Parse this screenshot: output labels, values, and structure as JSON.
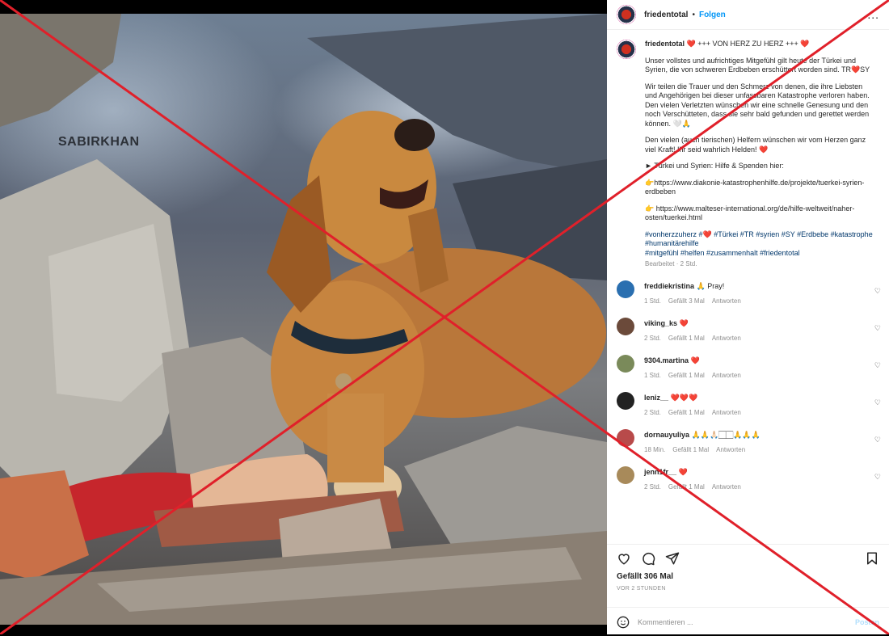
{
  "photo": {
    "watermark": "SABIRKHAN"
  },
  "header": {
    "username": "friedentotal",
    "separator": "•",
    "follow": "Folgen",
    "more": "..."
  },
  "caption": {
    "username": "friedentotal",
    "title": "❤️ +++ VON HERZ ZU HERZ +++ ❤️",
    "p1": "Unser vollstes und aufrichtiges Mitgefühl gilt heute der Türkei und Syrien, die von schweren Erdbeben erschüttert worden sind. TR❤️SY",
    "p2": "Wir teilen die Trauer und den Schmerz von denen, die ihre Liebsten und Angehörigen bei dieser unfassbaren Katastrophe verloren haben. Den vielen Verletzten wünschen wir eine schnelle Genesung und den noch Verschütteten, dass sie sehr bald gefunden und gerettet werden können. 🤍🙏",
    "p3": "Den vielen (auch tierischen) Helfern wünschen wir vom Herzen ganz viel Kraft! Ihr seid wahrlich Helden! ❤️",
    "p4": "► Türkei und Syrien: Hilfe & Spenden hier:",
    "p5": "👉https://www.diakonie-katastrophenhilfe.de/projekte/tuerkei-syrien-erdbeben",
    "p6": "👉 https://www.malteser-international.org/de/hilfe-weltweit/naher-osten/tuerkei.html",
    "tags": "#vonherzzuherz #❤️ #Türkei #TR #syrien #SY #Erdbebe #katastrophe #humanitärehilfe\n#mitgefühl #helfen #zusammenhalt #friedentotal",
    "edited": "Bearbeitet · 2 Std."
  },
  "comments": [
    {
      "user": "freddiekristina",
      "text": "🙏 Pray!",
      "time": "1 Std.",
      "likes": "Gefällt 3 Mal",
      "reply": "Antworten",
      "color": "#2a6fb0"
    },
    {
      "user": "viking_ks",
      "text": "❤️",
      "time": "2 Std.",
      "likes": "Gefällt 1 Mal",
      "reply": "Antworten",
      "color": "#6b4a3a"
    },
    {
      "user": "9304.martina",
      "text": "❤️",
      "time": "1 Std.",
      "likes": "Gefällt 1 Mal",
      "reply": "Antworten",
      "color": "#7a8a5a"
    },
    {
      "user": "leniz__",
      "text": "❤️❤️❤️",
      "time": "2 Std.",
      "likes": "Gefällt 1 Mal",
      "reply": "Antworten",
      "color": "#222222"
    },
    {
      "user": "dornauyuliya",
      "text": "🙏🙏🙏🏻🏻🏻🙏🙏🙏",
      "time": "18 Min.",
      "likes": "Gefällt 1 Mal",
      "reply": "Antworten",
      "color": "#b84a4a"
    },
    {
      "user": "jenn1fr__",
      "text": "❤️",
      "time": "2 Std.",
      "likes": "Gefällt 1 Mal",
      "reply": "Antworten",
      "color": "#a88a5a"
    }
  ],
  "footer": {
    "likes": "Gefällt 306 Mal",
    "ago": "VOR 2 STUNDEN",
    "comment_placeholder": "Kommentieren ...",
    "post": "Posten"
  },
  "icons": {
    "like": "heart-icon",
    "comment": "comment-icon",
    "share": "paper-plane-icon",
    "save": "bookmark-icon",
    "emoji": "emoji-icon",
    "comment_like": "heart-icon"
  },
  "colors": {
    "link": "#00376b",
    "follow": "#0095f6",
    "cross": "#e0202a"
  }
}
